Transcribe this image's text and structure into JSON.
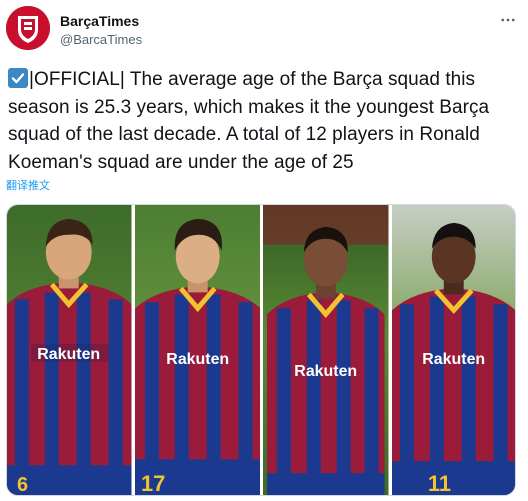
{
  "tweet": {
    "author_name": "BarçaTimes",
    "author_handle": "@BarcaTimes",
    "text_after_emoji": "|OFFICIAL| The average age of the Barça squad this season is 25.3 years, which makes it the youngest Barça squad of the last decade. A total of 12 players in Ronald Koeman's squad are under the age of 25",
    "translate_link": "翻译推文"
  },
  "media": {
    "photos": [
      {
        "sponsor_text": "Rakuten",
        "shirt_number": "6"
      },
      {
        "sponsor_text": "Rakuten",
        "shirt_number": "17"
      },
      {
        "sponsor_text": "Rakuten",
        "shirt_number": ""
      },
      {
        "sponsor_text": "Rakuten",
        "shirt_number": "11"
      }
    ]
  },
  "icons": {
    "avatar": "barca-times-logo-icon",
    "emoji": "check-mark-button-icon",
    "more": "more-options-icon"
  },
  "colors": {
    "link": "#1d9bf0",
    "text": "#0f1419",
    "secondary": "#536471",
    "brand_red": "#c8102e",
    "jersey_blue": "#1b3a8f",
    "jersey_garnet": "#9b1b3a",
    "jersey_gold": "#f2c230"
  }
}
